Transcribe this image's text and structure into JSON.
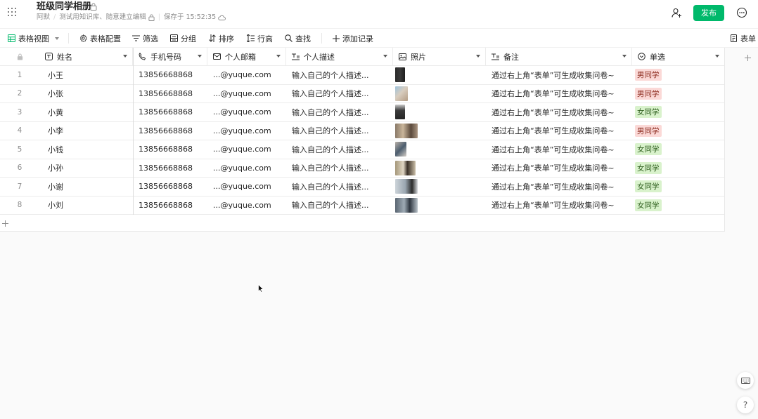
{
  "header": {
    "title": "班级同学相册",
    "owner": "阿默",
    "book": "测试用知识库、随意建立编辑",
    "save_status": "保存于 15:52:35",
    "publish_label": "发布"
  },
  "toolbar": {
    "view_label": "表格视图",
    "config_label": "表格配置",
    "filter_label": "筛选",
    "group_label": "分组",
    "sort_label": "排序",
    "row_height_label": "行高",
    "search_label": "查找",
    "add_record_label": "添加记录",
    "form_label": "表单"
  },
  "columns": [
    {
      "label": "姓名",
      "icon": "text-icon"
    },
    {
      "label": "手机号码",
      "icon": "phone-icon"
    },
    {
      "label": "个人邮箱",
      "icon": "mail-icon"
    },
    {
      "label": "个人描述",
      "icon": "long-text-icon"
    },
    {
      "label": "照片",
      "icon": "image-icon"
    },
    {
      "label": "备注",
      "icon": "long-text-icon"
    },
    {
      "label": "单选",
      "icon": "single-select-icon"
    }
  ],
  "rows": [
    {
      "num": "1",
      "name": "小王",
      "phone": "13856668868",
      "email": "...@yuque.com",
      "desc": "输入自己的个人描述...",
      "note": "通过右上角“表单”可生成收集问卷~",
      "tag": "男同学",
      "tag_type": "male"
    },
    {
      "num": "2",
      "name": "小张",
      "phone": "13856668868",
      "email": "...@yuque.com",
      "desc": "输入自己的个人描述...",
      "note": "通过右上角“表单”可生成收集问卷~",
      "tag": "男同学",
      "tag_type": "male"
    },
    {
      "num": "3",
      "name": "小黄",
      "phone": "13856668868",
      "email": "...@yuque.com",
      "desc": "输入自己的个人描述...",
      "note": "通过右上角“表单”可生成收集问卷~",
      "tag": "女同学",
      "tag_type": "female"
    },
    {
      "num": "4",
      "name": "小李",
      "phone": "13856668868",
      "email": "...@yuque.com",
      "desc": "输入自己的个人描述...",
      "note": "通过右上角“表单”可生成收集问卷~",
      "tag": "男同学",
      "tag_type": "male"
    },
    {
      "num": "5",
      "name": "小钱",
      "phone": "13856668868",
      "email": "...@yuque.com",
      "desc": "输入自己的个人描述...",
      "note": "通过右上角“表单”可生成收集问卷~",
      "tag": "女同学",
      "tag_type": "female"
    },
    {
      "num": "6",
      "name": "小孙",
      "phone": "13856668868",
      "email": "...@yuque.com",
      "desc": "输入自己的个人描述...",
      "note": "通过右上角“表单”可生成收集问卷~",
      "tag": "女同学",
      "tag_type": "female"
    },
    {
      "num": "7",
      "name": "小谢",
      "phone": "13856668868",
      "email": "...@yuque.com",
      "desc": "输入自己的个人描述...",
      "note": "通过右上角“表单”可生成收集问卷~",
      "tag": "女同学",
      "tag_type": "female"
    },
    {
      "num": "8",
      "name": "小刘",
      "phone": "13856668868",
      "email": "...@yuque.com",
      "desc": "输入自己的个人描述...",
      "note": "通过右上角“表单”可生成收集问卷~",
      "tag": "女同学",
      "tag_type": "female"
    }
  ],
  "help_label": "?",
  "colors": {
    "accent": "#00b96b",
    "male_tag_bg": "#fbd9d7",
    "female_tag_bg": "#d9f2cc"
  }
}
